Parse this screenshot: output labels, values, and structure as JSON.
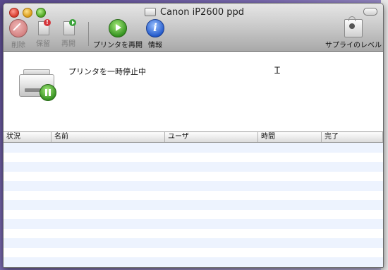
{
  "window": {
    "title": "Canon iP2600 ppd"
  },
  "toolbar": {
    "delete_label": "削除",
    "hold_label": "保留",
    "resume_label": "再開",
    "resume_printer_label": "プリンタを再開",
    "info_label": "情報",
    "supply_levels_label": "サプライのレベル"
  },
  "status": {
    "message": "プリンタを一時停止中"
  },
  "table": {
    "columns": [
      "状況",
      "名前",
      "ユーザ",
      "時間",
      "完了"
    ],
    "rows": []
  }
}
